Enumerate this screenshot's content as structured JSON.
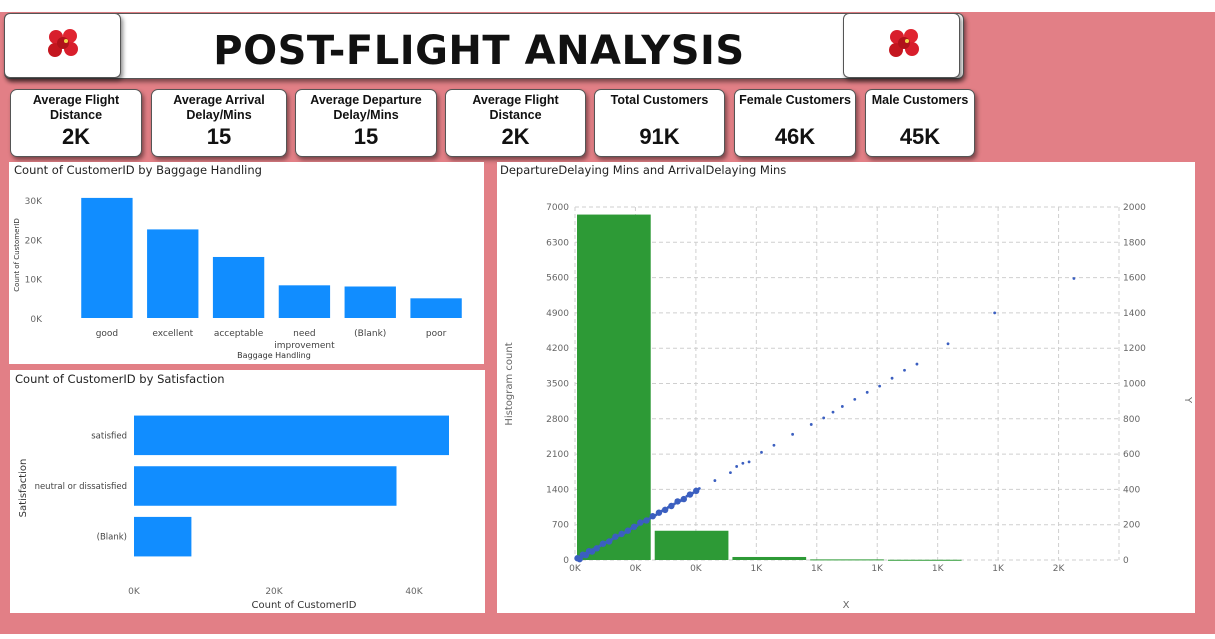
{
  "header": {
    "title": "POST-FLIGHT ANALYSIS"
  },
  "colors": {
    "background": "#e27f86",
    "bar_blue": "#118dff",
    "hist_green": "#2d9a36",
    "scatter_blue": "#3b5fc0"
  },
  "icons": {
    "logo": "hibiscus-flower-logo-icon"
  },
  "kpis": [
    {
      "label": "Average Flight Distance",
      "value": "2K"
    },
    {
      "label": "Average Arrival Delay/Mins",
      "value": "15"
    },
    {
      "label": "Average Departure Delay/Mins",
      "value": "15"
    },
    {
      "label": "Average Flight Distance",
      "value": "2K"
    },
    {
      "label": "Total Customers",
      "value": "91K"
    },
    {
      "label": "Female Customers",
      "value": "46K"
    },
    {
      "label": "Male Customers",
      "value": "45K"
    }
  ],
  "chart_data": [
    {
      "type": "bar",
      "title": "Count of CustomerID by Baggage Handling",
      "xlabel": "Baggage Handling",
      "ylabel": "Count of CustomerID",
      "categories": [
        "good",
        "excellent",
        "acceptable",
        "need improvement",
        "(Blank)",
        "poor"
      ],
      "values": [
        30500,
        22500,
        15500,
        8300,
        8000,
        5000
      ],
      "yticks": [
        "0K",
        "10K",
        "20K",
        "30K"
      ],
      "ylim": [
        0,
        32000
      ]
    },
    {
      "type": "bar",
      "orientation": "horizontal",
      "title": "Count of CustomerID by Satisfaction",
      "xlabel": "Count of CustomerID",
      "ylabel": "Satisfaction",
      "categories": [
        "satisfied",
        "neutral or dissatisfied",
        "(Blank)"
      ],
      "values": [
        45000,
        37500,
        8200
      ],
      "xticks": [
        "0K",
        "20K",
        "40K"
      ],
      "xlim": [
        0,
        48000
      ]
    },
    {
      "type": "scatter",
      "title": "DepartureDelaying Mins and ArrivalDelaying Mins",
      "xlabel": "X",
      "ylabel_left": "Histogram count",
      "ylabel_right": "Y",
      "x_tick_labels": [
        "0K",
        "0K",
        "0K",
        "1K",
        "1K",
        "1K",
        "1K",
        "1K",
        "2K"
      ],
      "left_ticks": [
        "0",
        "700",
        "1400",
        "2100",
        "2800",
        "3500",
        "4200",
        "4900",
        "5600",
        "6300",
        "7000"
      ],
      "right_ticks": [
        "0",
        "200",
        "400",
        "600",
        "800",
        "1000",
        "1200",
        "1400",
        "1600",
        "1800",
        "2000"
      ],
      "histogram": [
        {
          "bin": [
            0,
            250
          ],
          "count": 6850
        },
        {
          "bin": [
            250,
            500
          ],
          "count": 580
        },
        {
          "bin": [
            500,
            750
          ],
          "count": 60
        },
        {
          "bin": [
            750,
            1000
          ],
          "count": 12
        },
        {
          "bin": [
            1000,
            1250
          ],
          "count": 5
        }
      ],
      "scatter_points": [
        [
          20,
          25
        ],
        [
          40,
          45
        ],
        [
          60,
          62
        ],
        [
          80,
          80
        ],
        [
          100,
          100
        ],
        [
          120,
          118
        ],
        [
          140,
          138
        ],
        [
          160,
          155
        ],
        [
          180,
          178
        ],
        [
          200,
          195
        ],
        [
          220,
          218
        ],
        [
          240,
          235
        ],
        [
          260,
          255
        ],
        [
          280,
          278
        ],
        [
          300,
          298
        ],
        [
          320,
          318
        ],
        [
          340,
          336
        ],
        [
          360,
          362
        ],
        [
          380,
          380
        ],
        [
          400,
          405
        ],
        [
          450,
          450
        ],
        [
          500,
          495
        ],
        [
          520,
          530
        ],
        [
          540,
          548
        ],
        [
          560,
          556
        ],
        [
          600,
          610
        ],
        [
          640,
          650
        ],
        [
          700,
          712
        ],
        [
          760,
          768
        ],
        [
          800,
          805
        ],
        [
          830,
          838
        ],
        [
          860,
          870
        ],
        [
          900,
          910
        ],
        [
          940,
          950
        ],
        [
          980,
          985
        ],
        [
          1020,
          1030
        ],
        [
          1060,
          1075
        ],
        [
          1100,
          1110
        ],
        [
          1200,
          1225
        ],
        [
          1350,
          1400
        ],
        [
          1605,
          1595
        ]
      ],
      "xlim": [
        0,
        1750
      ],
      "ylim_left": [
        0,
        7000
      ],
      "ylim_right": [
        0,
        2000
      ],
      "grid": true
    }
  ]
}
